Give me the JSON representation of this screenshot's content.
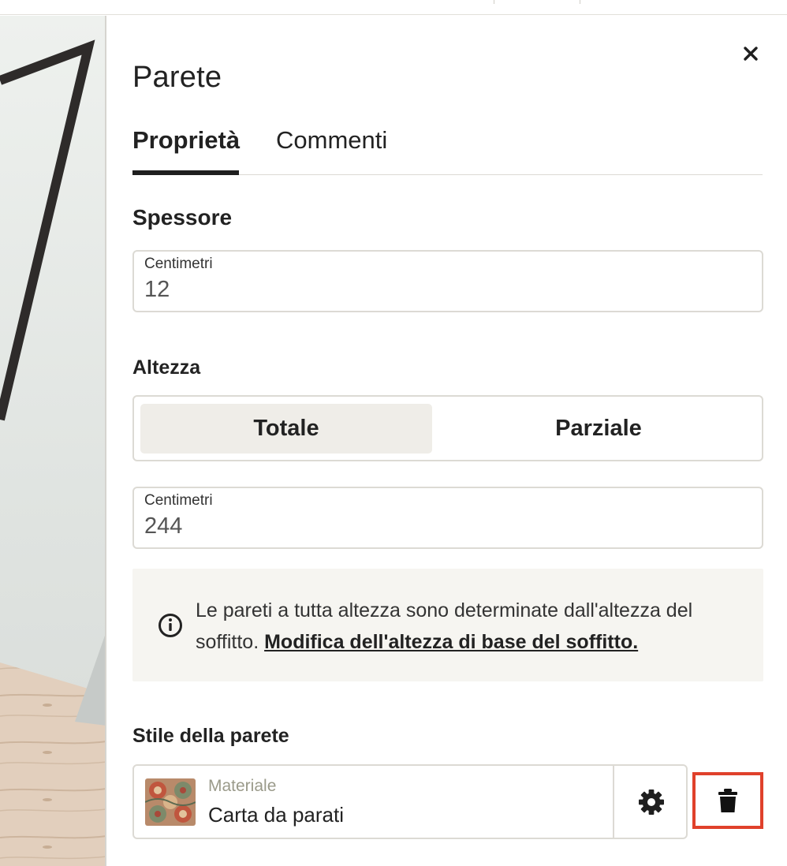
{
  "panel": {
    "title": "Parete",
    "close_icon": "close-icon"
  },
  "tabs": [
    {
      "label": "Proprietà",
      "active": true
    },
    {
      "label": "Commenti",
      "active": false
    }
  ],
  "thickness": {
    "section_title": "Spessore",
    "unit_label": "Centimetri",
    "value": "12"
  },
  "height": {
    "section_title": "Altezza",
    "options": [
      {
        "label": "Totale",
        "selected": true
      },
      {
        "label": "Parziale",
        "selected": false
      }
    ],
    "unit_label": "Centimetri",
    "value": "244"
  },
  "info": {
    "icon": "info-icon",
    "text": "Le pareti a tutta altezza sono determinate dall'altezza del soffitto.",
    "link": "Modifica dell'altezza di base del soffitto."
  },
  "wall_style": {
    "section_title": "Stile della parete",
    "material_label": "Materiale",
    "material_value": "Carta da parati",
    "settings_icon": "gear-icon",
    "delete_icon": "trash-icon"
  },
  "colors": {
    "accent_dark": "#1f1f1f",
    "border": "#dcdad4",
    "selected_segment": "#efede8",
    "info_background": "#f6f5f1",
    "highlight_red": "#e0412b",
    "muted_label": "#9a9a8a"
  }
}
